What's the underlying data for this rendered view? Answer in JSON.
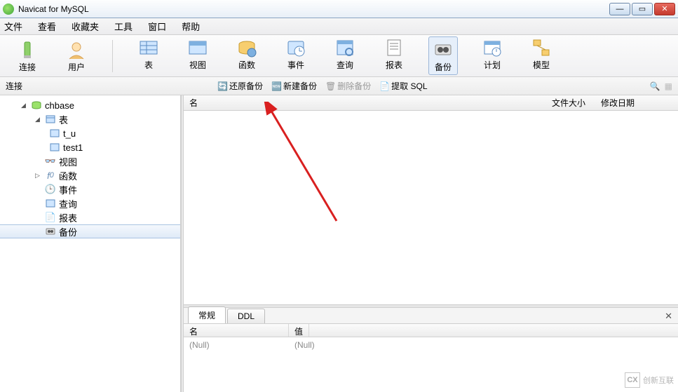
{
  "window": {
    "title": "Navicat for MySQL"
  },
  "menu": {
    "file": "文件",
    "view": "查看",
    "fav": "收藏夹",
    "tools": "工具",
    "window": "窗口",
    "help": "帮助"
  },
  "toolbar": {
    "connect": "连接",
    "user": "用户",
    "table": "表",
    "viewobj": "视图",
    "function": "函数",
    "event": "事件",
    "query": "查询",
    "report": "报表",
    "backup": "备份",
    "schedule": "计划",
    "model": "模型"
  },
  "subbar": {
    "left": "连接",
    "restore": "还原备份",
    "new": "新建备份",
    "delete": "删除备份",
    "extract": "提取 SQL"
  },
  "tree": {
    "db": "chbase",
    "tables": "表",
    "t_u": "t_u",
    "test1": "test1",
    "views": "视图",
    "functions": "函数",
    "events": "事件",
    "queries": "查询",
    "reports": "报表",
    "backup": "备份"
  },
  "listcols": {
    "name": "名",
    "size": "文件大小",
    "date": "修改日期"
  },
  "tabs": {
    "general": "常规",
    "ddl": "DDL"
  },
  "propcols": {
    "name": "名",
    "value": "值"
  },
  "propvals": {
    "name_null": "(Null)",
    "value_null": "(Null)"
  },
  "watermark": {
    "text": "创新互联"
  }
}
